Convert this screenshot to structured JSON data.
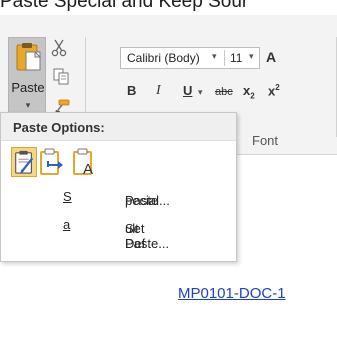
{
  "caption": {
    "text": "Paste Special and Keep Sour"
  },
  "ribbon": {
    "clipboard": {
      "paste_label": "Paste",
      "paste_arrow": "▾",
      "icons": [
        "paste-icon",
        "cut-icon",
        "copy-icon",
        "format-painter-icon"
      ]
    },
    "font": {
      "font_name": "Calibri (Body)",
      "font_dropdown": "▾",
      "font_size": "11",
      "size_dropdown": "▾",
      "grow_font": "A",
      "bold": "B",
      "italic": "I",
      "underline": "U",
      "underline_dropdown": "▾",
      "strikethrough": "abc",
      "subscript_base": "x",
      "subscript_mark": "2",
      "superscript_base": "x",
      "superscript_mark": "2",
      "group_label": "Font"
    }
  },
  "paste_menu": {
    "header": "Paste Options:",
    "options": [
      {
        "name": "keep-source-formatting",
        "icon": "clipboard-brush-icon"
      },
      {
        "name": "merge-formatting",
        "icon": "clipboard-arrow-icon"
      },
      {
        "name": "keep-text-only",
        "icon": "clipboard-text-icon"
      }
    ],
    "items": [
      {
        "label_pre": "Paste ",
        "accel": "S",
        "label_post": "pecial..."
      },
      {
        "label_pre": "Set Def",
        "accel": "a",
        "label_post": "ult Paste..."
      }
    ]
  },
  "document": {
    "link_text": "MP0101-DOC-1"
  },
  "colors": {
    "ribbon_bg": "#f3f3f3",
    "paste_button_active": "#c5c5c5",
    "menu_header_bg": "#efefef",
    "selected_option_bg": "#f6d684",
    "link": "#1f3fc8",
    "clipboard_gold": "#e6a82a"
  }
}
